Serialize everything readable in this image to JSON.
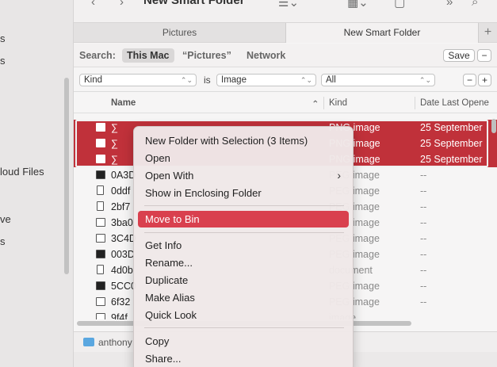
{
  "sidebar": {
    "items": [
      {
        "label": "s"
      },
      {
        "label": "s"
      },
      {
        "label": "loud Files"
      },
      {
        "label": "ve"
      },
      {
        "label": "s"
      }
    ]
  },
  "toolbar": {
    "title": "New Smart Folder"
  },
  "tabs": [
    {
      "label": "Pictures"
    },
    {
      "label": "New Smart Folder"
    }
  ],
  "search": {
    "label": "Search:",
    "scopes": [
      "This Mac",
      "“Pictures”",
      "Network"
    ],
    "save_label": "Save",
    "remove_label": "−"
  },
  "criteria": {
    "attribute": "Kind",
    "operator": "is",
    "value": "Image",
    "qualifier": "All",
    "remove_label": "−",
    "add_label": "+"
  },
  "columns": {
    "name": "Name",
    "kind": "Kind",
    "date": "Date Last Opene"
  },
  "rows": [
    {
      "name": "∑",
      "kind": "PNG image",
      "date": "25 September",
      "selected": true,
      "icon": "image-file-icon"
    },
    {
      "name": "∑",
      "kind": "PNG image",
      "date": "25 September",
      "selected": true,
      "icon": "image-file-icon"
    },
    {
      "name": "∑",
      "kind": "PNG image",
      "date": "25 September",
      "selected": true,
      "icon": "image-file-icon"
    },
    {
      "name": "0A3D",
      "kind": "PEG image",
      "date": "--",
      "selected": false,
      "icon": "dark-image-icon"
    },
    {
      "name": "0ddf",
      "kind": "PEG image",
      "date": "--",
      "selected": false,
      "icon": "document-icon"
    },
    {
      "name": "2bf7",
      "kind": "PEG image",
      "date": "--",
      "selected": false,
      "icon": "document-icon"
    },
    {
      "name": "3ba0",
      "kind": "PEG image",
      "date": "--",
      "selected": false,
      "icon": "image-file-icon"
    },
    {
      "name": "3C4D",
      "kind": "PEG image",
      "date": "--",
      "selected": false,
      "icon": "image-file-icon"
    },
    {
      "name": "003D",
      "kind": "PEG image",
      "date": "--",
      "selected": false,
      "icon": "dark-image-icon"
    },
    {
      "name": "4d0b",
      "kind": "document",
      "date": "--",
      "selected": false,
      "icon": "document-icon"
    },
    {
      "name": "5CC0",
      "kind": "PEG image",
      "date": "--",
      "selected": false,
      "icon": "dark-image-icon"
    },
    {
      "name": "6f32",
      "kind": "PEG image",
      "date": "--",
      "selected": false,
      "icon": "image-file-icon"
    },
    {
      "name": "9f4f",
      "kind": "image",
      "date": "",
      "selected": false,
      "icon": "image-file-icon"
    }
  ],
  "pathbar": {
    "path": "anthony"
  },
  "context_menu": {
    "items": [
      {
        "label": "New Folder with Selection (3 Items)"
      },
      {
        "label": "Open"
      },
      {
        "label": "Open With",
        "submenu": true
      },
      {
        "label": "Show in Enclosing Folder"
      },
      {
        "label": "Move to Bin",
        "highlighted": true
      },
      {
        "label": "Get Info"
      },
      {
        "label": "Rename..."
      },
      {
        "label": "Duplicate"
      },
      {
        "label": "Make Alias"
      },
      {
        "label": "Quick Look"
      },
      {
        "label": "Copy"
      },
      {
        "label": "Share..."
      }
    ],
    "highlight_color": "#d9404e"
  },
  "colors": {
    "selection": "#c0313a",
    "accent": "#d9404e"
  }
}
